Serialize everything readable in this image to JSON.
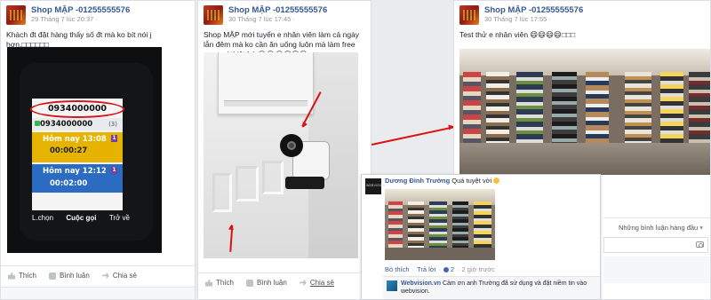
{
  "posts": [
    {
      "author": "Shop MẬP -01255555576",
      "time": "29 Tháng 7 lúc 20:37",
      "text": "Khách đt đặt hàng thấy số đt mà ko bít nói j hơn.□□□□□□",
      "phone": {
        "number_top": "0934000000",
        "number_second": "0934000000",
        "count": "(3)",
        "entry1_time": "Hôm nay 13:08",
        "entry1_duration": "00:00:27",
        "entry2_time": "Hôm nay 12:12",
        "entry2_duration": "00:02:00",
        "badge": "1",
        "soft_left": "L.chọn",
        "soft_center": "Cuộc gọi",
        "soft_right": "Trở về"
      },
      "actions": {
        "like": "Thích",
        "comment": "Bình luận",
        "share": "Chia sẻ"
      }
    },
    {
      "author": "Shop MẬP -01255555576",
      "time": "30 Tháng 7 lúc 17:45",
      "text": "Shop MẬP mới tuyển e nhân viên làm cả ngày lẫn đêm mà ko cần ăn uống luôn mà làm free nưa vui thiệt hý 😂😂😂😄😄😄",
      "actions": {
        "like": "Thích",
        "comment": "Bình luận",
        "share": "Chia sẻ"
      }
    },
    {
      "author": "Shop MẬP -01255555576",
      "time": "30 Tháng 7 lúc 17:55",
      "text": "Test thử e nhân viên 😄😄😄😄□□□",
      "sort_label": "Những bình luận hàng đầu"
    }
  ],
  "comment": {
    "author": "Dương Đình Trường",
    "text": "Quá tuyệt vời",
    "avatar_text": "WEBVISION",
    "like": "Bỏ thích",
    "reply": "Trả lời",
    "likes_count": "2",
    "time": "2 giờ trước",
    "reply_author": "Webvision.vn",
    "reply_text": "Cảm ơn anh Trường đã sử dụng và đặt niềm tin vào webvision."
  },
  "colors": {
    "link_blue": "#365899",
    "annotation_red": "#d3141c",
    "phone_highlight": "#e6b400",
    "phone_blue": "#2b6bc2"
  }
}
